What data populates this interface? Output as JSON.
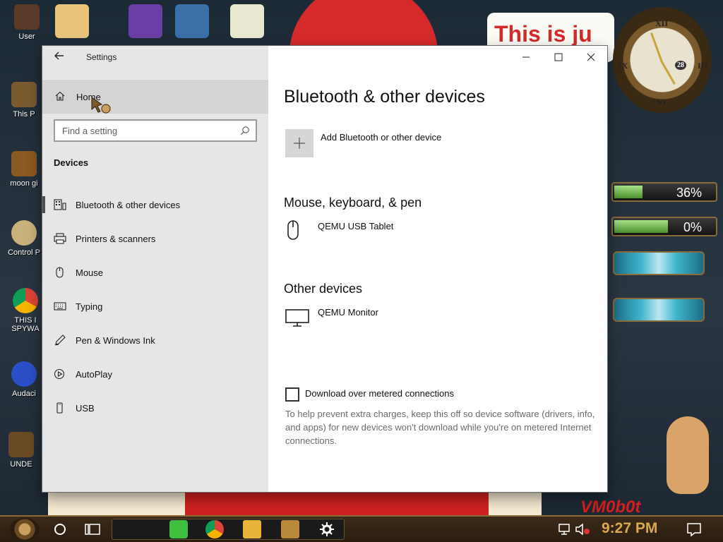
{
  "desktop": {
    "banner_text": "This is ju",
    "vm_badge": "VM0b0t",
    "icons": [
      {
        "label": "User",
        "name": "desktop-icon-user"
      },
      {
        "label": "This P",
        "name": "desktop-icon-this-pc"
      },
      {
        "label": "moon gi",
        "name": "desktop-icon-moon"
      },
      {
        "label": "Control P",
        "name": "desktop-icon-control-panel"
      },
      {
        "label": "THIS I",
        "name": "desktop-icon-chrome-shortcut"
      },
      {
        "label": "SPYWA",
        "name": "desktop-icon-spyware-label"
      },
      {
        "label": "Audaci",
        "name": "desktop-icon-audacity"
      },
      {
        "label": "UNDE",
        "name": "desktop-icon-unde"
      }
    ],
    "gauges": [
      {
        "label": "36%",
        "value": 0.36
      },
      {
        "label": "0%",
        "value": 0.0
      }
    ],
    "clock_day": "28"
  },
  "window": {
    "title": "Settings",
    "controls": {
      "minimize": "minimize",
      "maximize": "maximize",
      "close": "close"
    }
  },
  "sidebar": {
    "home_label": "Home",
    "search_placeholder": "Find a setting",
    "section_label": "Devices",
    "items": [
      {
        "label": "Bluetooth & other devices",
        "icon": "bluetooth-devices-icon",
        "selected": true
      },
      {
        "label": "Printers & scanners",
        "icon": "printer-icon",
        "selected": false
      },
      {
        "label": "Mouse",
        "icon": "mouse-icon",
        "selected": false
      },
      {
        "label": "Typing",
        "icon": "keyboard-icon",
        "selected": false
      },
      {
        "label": "Pen & Windows Ink",
        "icon": "pen-icon",
        "selected": false
      },
      {
        "label": "AutoPlay",
        "icon": "autoplay-icon",
        "selected": false
      },
      {
        "label": "USB",
        "icon": "usb-icon",
        "selected": false
      }
    ]
  },
  "main": {
    "page_title": "Bluetooth & other devices",
    "add_device_label": "Add Bluetooth or other device",
    "groups": [
      {
        "title": "Mouse, keyboard, & pen",
        "devices": [
          {
            "name": "QEMU USB Tablet",
            "icon": "mouse-icon"
          }
        ]
      },
      {
        "title": "Other devices",
        "devices": [
          {
            "name": "QEMU Monitor",
            "icon": "monitor-icon"
          }
        ]
      }
    ],
    "metered_checkbox_label": "Download over metered connections",
    "metered_checked": false,
    "metered_help": "To help prevent extra charges, keep this off so device software (drivers, info, and apps) for new devices won't download while you're on metered Internet connections."
  },
  "taskbar": {
    "time": "9:27 PM",
    "pinned_apps": [
      "notes-app-icon",
      "chrome-icon",
      "file-explorer-icon",
      "game-app-icon",
      "settings-gear-icon"
    ]
  }
}
